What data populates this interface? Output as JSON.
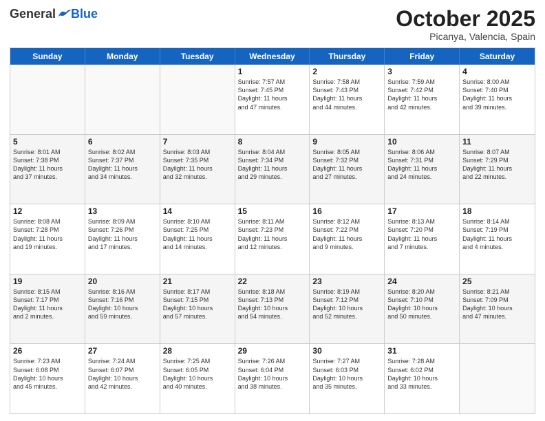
{
  "header": {
    "logo_general": "General",
    "logo_blue": "Blue",
    "month_title": "October 2025",
    "location": "Picanya, Valencia, Spain"
  },
  "days_of_week": [
    "Sunday",
    "Monday",
    "Tuesday",
    "Wednesday",
    "Thursday",
    "Friday",
    "Saturday"
  ],
  "rows": [
    [
      {
        "day": "",
        "empty": true
      },
      {
        "day": "",
        "empty": true
      },
      {
        "day": "",
        "empty": true
      },
      {
        "day": "1",
        "lines": [
          "Sunrise: 7:57 AM",
          "Sunset: 7:45 PM",
          "Daylight: 11 hours",
          "and 47 minutes."
        ]
      },
      {
        "day": "2",
        "lines": [
          "Sunrise: 7:58 AM",
          "Sunset: 7:43 PM",
          "Daylight: 11 hours",
          "and 44 minutes."
        ]
      },
      {
        "day": "3",
        "lines": [
          "Sunrise: 7:59 AM",
          "Sunset: 7:42 PM",
          "Daylight: 11 hours",
          "and 42 minutes."
        ]
      },
      {
        "day": "4",
        "lines": [
          "Sunrise: 8:00 AM",
          "Sunset: 7:40 PM",
          "Daylight: 11 hours",
          "and 39 minutes."
        ]
      }
    ],
    [
      {
        "day": "5",
        "lines": [
          "Sunrise: 8:01 AM",
          "Sunset: 7:38 PM",
          "Daylight: 11 hours",
          "and 37 minutes."
        ]
      },
      {
        "day": "6",
        "lines": [
          "Sunrise: 8:02 AM",
          "Sunset: 7:37 PM",
          "Daylight: 11 hours",
          "and 34 minutes."
        ]
      },
      {
        "day": "7",
        "lines": [
          "Sunrise: 8:03 AM",
          "Sunset: 7:35 PM",
          "Daylight: 11 hours",
          "and 32 minutes."
        ]
      },
      {
        "day": "8",
        "lines": [
          "Sunrise: 8:04 AM",
          "Sunset: 7:34 PM",
          "Daylight: 11 hours",
          "and 29 minutes."
        ]
      },
      {
        "day": "9",
        "lines": [
          "Sunrise: 8:05 AM",
          "Sunset: 7:32 PM",
          "Daylight: 11 hours",
          "and 27 minutes."
        ]
      },
      {
        "day": "10",
        "lines": [
          "Sunrise: 8:06 AM",
          "Sunset: 7:31 PM",
          "Daylight: 11 hours",
          "and 24 minutes."
        ]
      },
      {
        "day": "11",
        "lines": [
          "Sunrise: 8:07 AM",
          "Sunset: 7:29 PM",
          "Daylight: 11 hours",
          "and 22 minutes."
        ]
      }
    ],
    [
      {
        "day": "12",
        "lines": [
          "Sunrise: 8:08 AM",
          "Sunset: 7:28 PM",
          "Daylight: 11 hours",
          "and 19 minutes."
        ]
      },
      {
        "day": "13",
        "lines": [
          "Sunrise: 8:09 AM",
          "Sunset: 7:26 PM",
          "Daylight: 11 hours",
          "and 17 minutes."
        ]
      },
      {
        "day": "14",
        "lines": [
          "Sunrise: 8:10 AM",
          "Sunset: 7:25 PM",
          "Daylight: 11 hours",
          "and 14 minutes."
        ]
      },
      {
        "day": "15",
        "lines": [
          "Sunrise: 8:11 AM",
          "Sunset: 7:23 PM",
          "Daylight: 11 hours",
          "and 12 minutes."
        ]
      },
      {
        "day": "16",
        "lines": [
          "Sunrise: 8:12 AM",
          "Sunset: 7:22 PM",
          "Daylight: 11 hours",
          "and 9 minutes."
        ]
      },
      {
        "day": "17",
        "lines": [
          "Sunrise: 8:13 AM",
          "Sunset: 7:20 PM",
          "Daylight: 11 hours",
          "and 7 minutes."
        ]
      },
      {
        "day": "18",
        "lines": [
          "Sunrise: 8:14 AM",
          "Sunset: 7:19 PM",
          "Daylight: 11 hours",
          "and 4 minutes."
        ]
      }
    ],
    [
      {
        "day": "19",
        "lines": [
          "Sunrise: 8:15 AM",
          "Sunset: 7:17 PM",
          "Daylight: 11 hours",
          "and 2 minutes."
        ]
      },
      {
        "day": "20",
        "lines": [
          "Sunrise: 8:16 AM",
          "Sunset: 7:16 PM",
          "Daylight: 10 hours",
          "and 59 minutes."
        ]
      },
      {
        "day": "21",
        "lines": [
          "Sunrise: 8:17 AM",
          "Sunset: 7:15 PM",
          "Daylight: 10 hours",
          "and 57 minutes."
        ]
      },
      {
        "day": "22",
        "lines": [
          "Sunrise: 8:18 AM",
          "Sunset: 7:13 PM",
          "Daylight: 10 hours",
          "and 54 minutes."
        ]
      },
      {
        "day": "23",
        "lines": [
          "Sunrise: 8:19 AM",
          "Sunset: 7:12 PM",
          "Daylight: 10 hours",
          "and 52 minutes."
        ]
      },
      {
        "day": "24",
        "lines": [
          "Sunrise: 8:20 AM",
          "Sunset: 7:10 PM",
          "Daylight: 10 hours",
          "and 50 minutes."
        ]
      },
      {
        "day": "25",
        "lines": [
          "Sunrise: 8:21 AM",
          "Sunset: 7:09 PM",
          "Daylight: 10 hours",
          "and 47 minutes."
        ]
      }
    ],
    [
      {
        "day": "26",
        "lines": [
          "Sunrise: 7:23 AM",
          "Sunset: 6:08 PM",
          "Daylight: 10 hours",
          "and 45 minutes."
        ]
      },
      {
        "day": "27",
        "lines": [
          "Sunrise: 7:24 AM",
          "Sunset: 6:07 PM",
          "Daylight: 10 hours",
          "and 42 minutes."
        ]
      },
      {
        "day": "28",
        "lines": [
          "Sunrise: 7:25 AM",
          "Sunset: 6:05 PM",
          "Daylight: 10 hours",
          "and 40 minutes."
        ]
      },
      {
        "day": "29",
        "lines": [
          "Sunrise: 7:26 AM",
          "Sunset: 6:04 PM",
          "Daylight: 10 hours",
          "and 38 minutes."
        ]
      },
      {
        "day": "30",
        "lines": [
          "Sunrise: 7:27 AM",
          "Sunset: 6:03 PM",
          "Daylight: 10 hours",
          "and 35 minutes."
        ]
      },
      {
        "day": "31",
        "lines": [
          "Sunrise: 7:28 AM",
          "Sunset: 6:02 PM",
          "Daylight: 10 hours",
          "and 33 minutes."
        ]
      },
      {
        "day": "",
        "empty": true
      }
    ]
  ]
}
